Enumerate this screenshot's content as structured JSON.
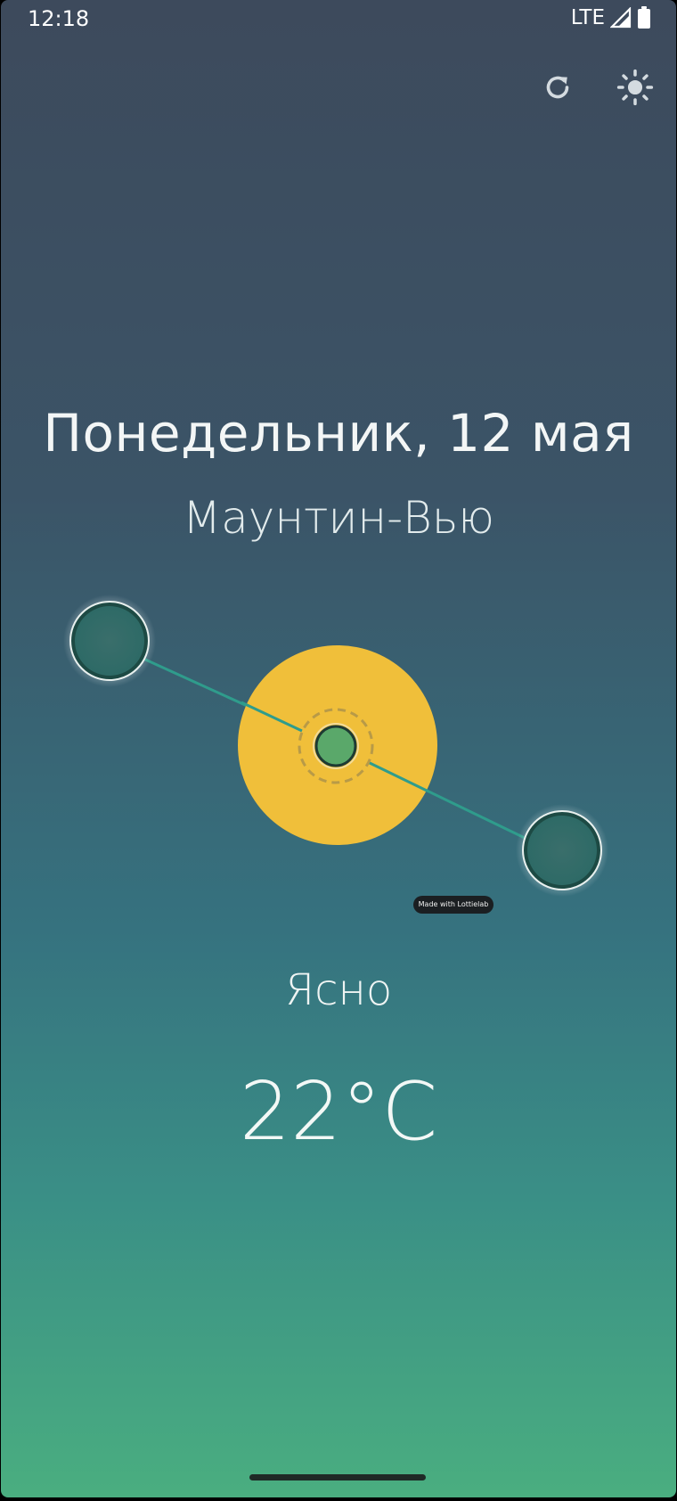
{
  "status_bar": {
    "time": "12:18",
    "network": "LTE",
    "icons": [
      "signal-icon",
      "battery-icon"
    ]
  },
  "toolbar": {
    "refresh_icon": "refresh-icon",
    "theme_icon": "sun-icon"
  },
  "weather": {
    "date": "Понедельник, 12 мая",
    "city": "Маунтин-Вью",
    "condition": "Ясно",
    "temperature": "22°C"
  },
  "animation": {
    "badge": "Made with Lottielab",
    "colors": {
      "sun": "#f0bf3a",
      "planet": "#2f6e68",
      "center": "#5aa86a",
      "line": "#2f9c8c"
    }
  }
}
